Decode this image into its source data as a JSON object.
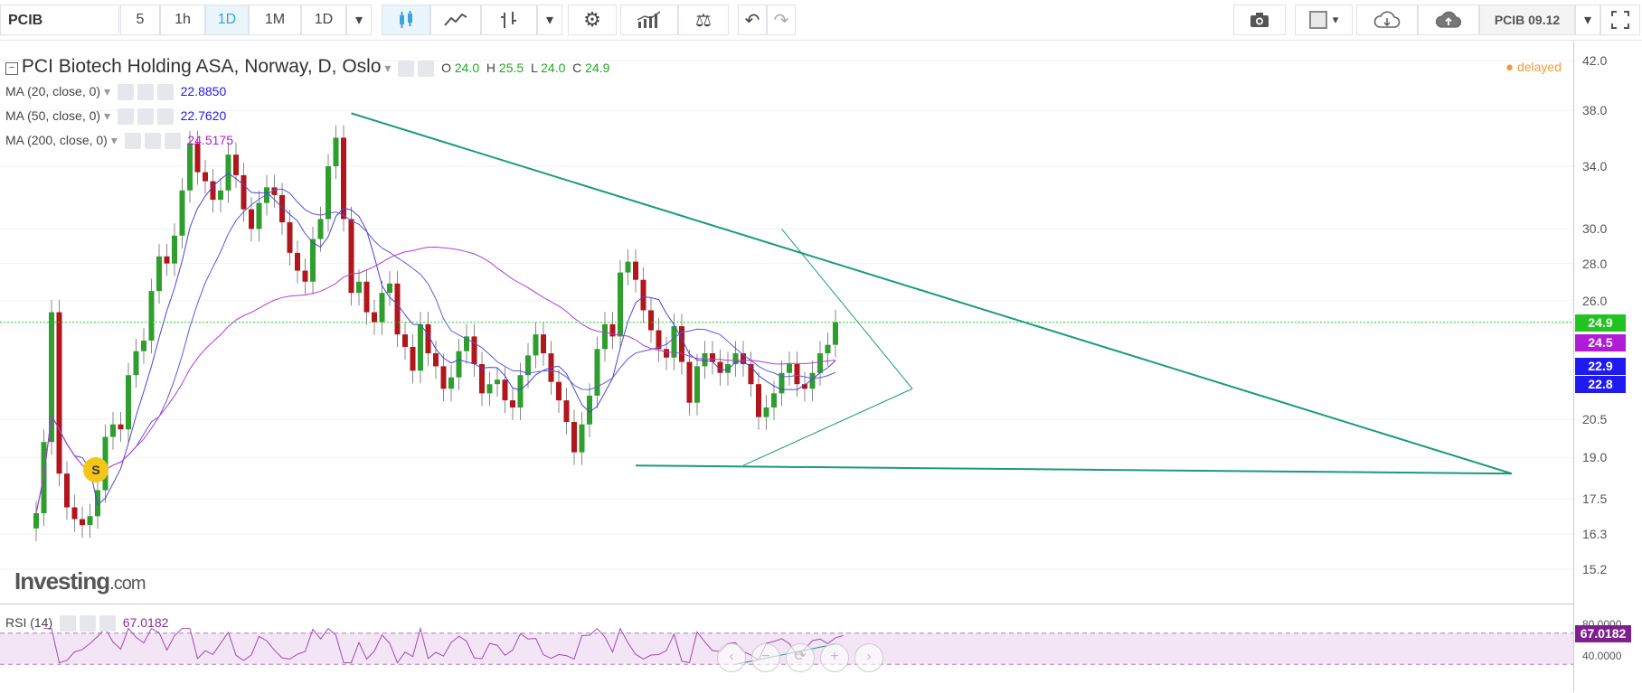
{
  "toolbar": {
    "symbol": "PCIB",
    "intervals": [
      "5",
      "1h",
      "1D",
      "1M",
      "1D"
    ],
    "active_interval": "1D",
    "symbol_tab": "PCIB 09.12",
    "icons": [
      "candles-icon",
      "line-style-icon",
      "bar-style-icon",
      "gear-icon",
      "indicators-icon",
      "compare-icon",
      "undo-icon",
      "redo-icon",
      "camera-icon",
      "layout-icon",
      "cloud-download-icon",
      "cloud-upload-icon",
      "fullscreen-icon"
    ]
  },
  "legend": {
    "title": "PCI Biotech Holding ASA, Norway, D, Oslo",
    "ohlc": {
      "O": "24.0",
      "H": "25.5",
      "L": "24.0",
      "C": "24.9"
    },
    "o_label": "O",
    "h_label": "H",
    "l_label": "L",
    "c_label": "C",
    "ma20_label": "MA (20, close, 0)",
    "ma20_value": "22.8850",
    "ma50_label": "MA (50, close, 0)",
    "ma50_value": "22.7620",
    "ma200_label": "MA (200, close, 0)",
    "ma200_value": "24.5175",
    "rsi_label": "RSI (14)",
    "rsi_value": "67.0182"
  },
  "status": {
    "delayed": "delayed",
    "signal_badge": "S"
  },
  "watermark": {
    "brand": "Investing",
    "suffix": ".com"
  },
  "colors": {
    "up": "#2e9f2e",
    "down": "#b0161b",
    "ma20": "#4b45d6",
    "ma50": "#5a58e0",
    "ma200": "#b43bd4",
    "trendline": "#1a9a7c",
    "rsi": "#9c4fb0",
    "price_tag": "#21c321",
    "ma200_tag": "#b21bd6",
    "ma_tag": "#1f1bf0"
  },
  "price_axis": {
    "ticks": [
      "42.0",
      "38.0",
      "34.0",
      "30.0",
      "28.0",
      "26.0",
      "20.5",
      "19.0",
      "17.5",
      "16.3",
      "15.2"
    ],
    "tags": [
      {
        "value": "24.9",
        "type": "price"
      },
      {
        "value": "24.5",
        "type": "ma200"
      },
      {
        "value": "22.9",
        "type": "ma"
      },
      {
        "value": "22.8",
        "type": "ma"
      }
    ]
  },
  "rsi_axis": {
    "ticks": [
      "80.0000",
      "40.0000"
    ],
    "tag": "67.0182"
  },
  "chart_data": {
    "type": "candlestick",
    "title": "PCI Biotech Holding ASA, Norway, D, Oslo",
    "ylim": [
      15.2,
      42.0
    ],
    "yscale": "log",
    "last": 24.9,
    "ma": [
      {
        "name": "MA (20, close, 0)",
        "value": 22.885
      },
      {
        "name": "MA (50, close, 0)",
        "value": 22.762
      },
      {
        "name": "MA (200, close, 0)",
        "value": 24.5175
      }
    ],
    "closes": [
      17.0,
      19.6,
      25.4,
      18.4,
      17.2,
      16.8,
      16.6,
      16.9,
      17.8,
      19.8,
      20.3,
      20.1,
      22.4,
      23.5,
      24.0,
      26.5,
      28.4,
      28.0,
      29.6,
      32.4,
      35.6,
      33.6,
      33.0,
      31.8,
      32.4,
      34.8,
      33.4,
      31.2,
      30.0,
      31.6,
      32.6,
      32.1,
      30.4,
      28.6,
      27.6,
      27.0,
      29.4,
      30.6,
      34.0,
      36.0,
      30.6,
      26.4,
      27.0,
      25.4,
      24.9,
      26.4,
      26.9,
      24.3,
      23.7,
      22.6,
      24.8,
      23.4,
      22.8,
      21.8,
      22.3,
      23.5,
      24.2,
      22.9,
      21.6,
      22.0,
      22.2,
      21.3,
      21.0,
      22.4,
      23.3,
      24.3,
      23.4,
      22.1,
      21.3,
      20.4,
      19.2,
      20.3,
      21.5,
      23.6,
      24.8,
      24.2,
      27.5,
      28.1,
      27.1,
      25.5,
      24.5,
      23.6,
      23.2,
      24.7,
      23.0,
      21.2,
      22.8,
      23.4,
      23.0,
      22.5,
      22.9,
      23.4,
      22.9,
      22.0,
      20.6,
      21.0,
      21.6,
      22.5,
      22.9,
      22.0,
      21.8,
      22.5,
      23.4,
      23.8,
      24.9
    ],
    "trendlines": [
      {
        "from": [
          41,
          37.8
        ],
        "to": [
          192,
          18.4
        ],
        "label": ""
      },
      {
        "from": [
          78,
          18.7
        ],
        "to": [
          192,
          18.4
        ],
        "label": ""
      },
      {
        "from": [
          92,
          18.7
        ],
        "to": [
          114,
          21.8
        ],
        "label": ""
      },
      {
        "from": [
          97,
          30.0
        ],
        "to": [
          114,
          21.8
        ],
        "label": ""
      }
    ],
    "rsi": {
      "name": "RSI (14)",
      "last": 67.0182,
      "overbought": 70,
      "oversold": 30
    }
  }
}
